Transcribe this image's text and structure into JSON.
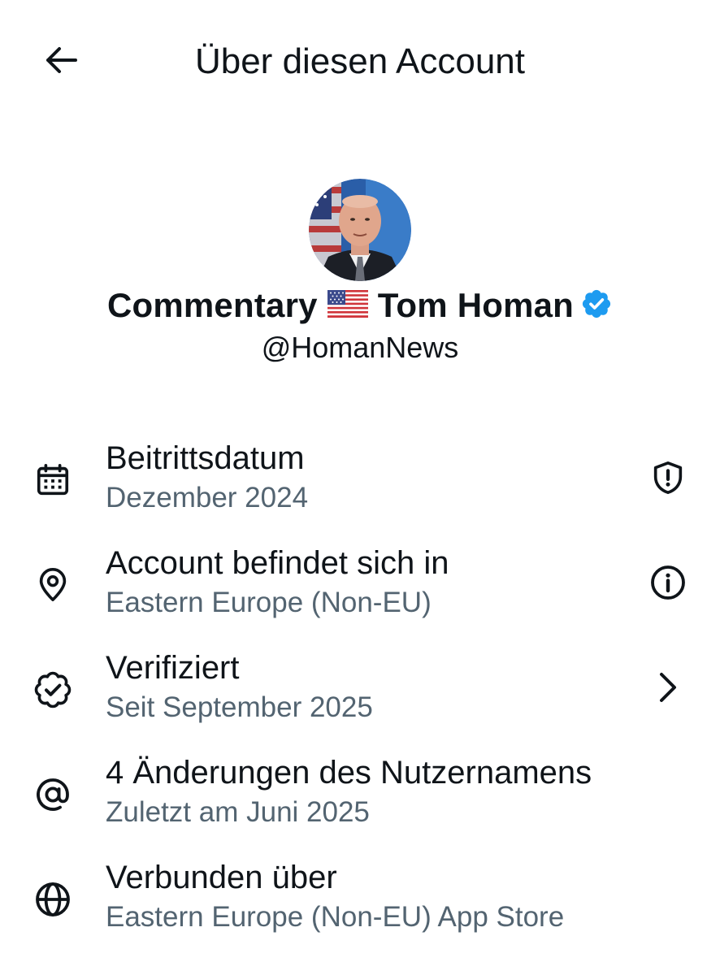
{
  "header": {
    "title": "Über diesen Account",
    "back_icon": "arrow-left-icon"
  },
  "profile": {
    "name_part1": "Commentary",
    "flag_icon": "us-flag-icon",
    "name_part2": "Tom Homan",
    "verified_icon": "verified-badge-icon",
    "handle": "@HomanNews"
  },
  "rows": [
    {
      "icon": "calendar-icon",
      "title": "Beitrittsdatum",
      "subtitle": "Dezember 2024",
      "action_icon": "shield-alert-icon"
    },
    {
      "icon": "location-pin-icon",
      "title": "Account befindet sich in",
      "subtitle": "Eastern Europe (Non-EU)",
      "action_icon": "info-icon"
    },
    {
      "icon": "verified-outline-icon",
      "title": "Verifiziert",
      "subtitle": "Seit September 2025",
      "action_icon": "chevron-right-icon"
    },
    {
      "icon": "at-sign-icon",
      "title": "4 Änderungen des Nutzernamens",
      "subtitle": "Zuletzt am Juni 2025",
      "action_icon": ""
    },
    {
      "icon": "globe-icon",
      "title": "Verbunden über",
      "subtitle": "Eastern Europe (Non-EU) App Store",
      "action_icon": ""
    }
  ],
  "colors": {
    "text_primary": "#0f1419",
    "text_secondary": "#536471",
    "verified_blue": "#1d9bf0",
    "icon": "#0f1419"
  }
}
